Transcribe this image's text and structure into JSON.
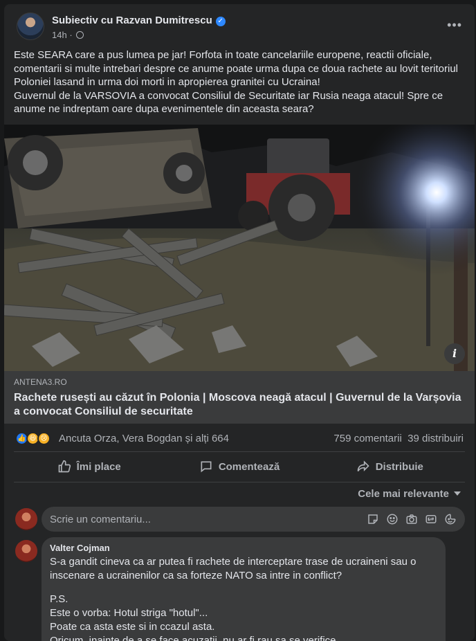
{
  "post": {
    "page_name": "Subiectiv cu Razvan Dumitrescu",
    "time": "14h",
    "more_label": "•••",
    "text": [
      "Este SEARA care a pus lumea pe jar! Forfota in toate cancelariile europene, reactii oficiale, comentarii si multe intrebari despre ce anume poate urma dupa ce doua rachete au lovit teritoriul Poloniei lasand in urma doi morti in apropierea granitei cu Ucraina!",
      "Guvernul de la VARSOVIA a convocat Consiliul de Securitate iar Rusia neaga atacul! Spre ce anume ne indreptam oare dupa evenimentele din aceasta seara?"
    ]
  },
  "link_preview": {
    "domain": "ANTENA3.RO",
    "title": "Rachete rusești au căzut în Polonia | Moscova neagă atacul | Guvernul de la Varșovia a convocat Consiliul de securitate",
    "info_icon": "i"
  },
  "stats": {
    "reaction_icons": [
      "like-icon",
      "haha-icon",
      "sad-icon"
    ],
    "reaction_names": "Ancuta Orza, Vera Bogdan și alți 664",
    "comments": "759 comentarii",
    "shares": "39 distribuiri"
  },
  "actions": {
    "like": "Îmi place",
    "comment": "Comentează",
    "share": "Distribuie"
  },
  "comments_section": {
    "sort_label": "Cele mai relevante",
    "input_placeholder": "Scrie un comentariu...",
    "input_icons": [
      "sticker-icon",
      "emoji-icon",
      "camera-icon",
      "gif-icon",
      "avatar-sticker-icon"
    ]
  },
  "comment": {
    "author": "Valter Cojman",
    "paragraph1": "S-a gandit cineva ca ar putea fi rachete de interceptare trase de ucraineni sau o inscenare a ucrainenilor ca sa forteze NATO sa intre in conflict?",
    "ps_lines": [
      "P.S.",
      "Este o vorba: Hotul striga \"hotul\"...",
      "Poate ca asta este si in ccazul asta.",
      "Oricum, inainte de a se face acuzatii, nu ar fi rau sa se verifice"
    ]
  },
  "colors": {
    "background": "#18191a",
    "card": "#242526",
    "surface": "#3a3b3c",
    "primary_text": "#e4e6eb",
    "secondary_text": "#b0b3b8",
    "verified_blue": "#2d88ff"
  }
}
